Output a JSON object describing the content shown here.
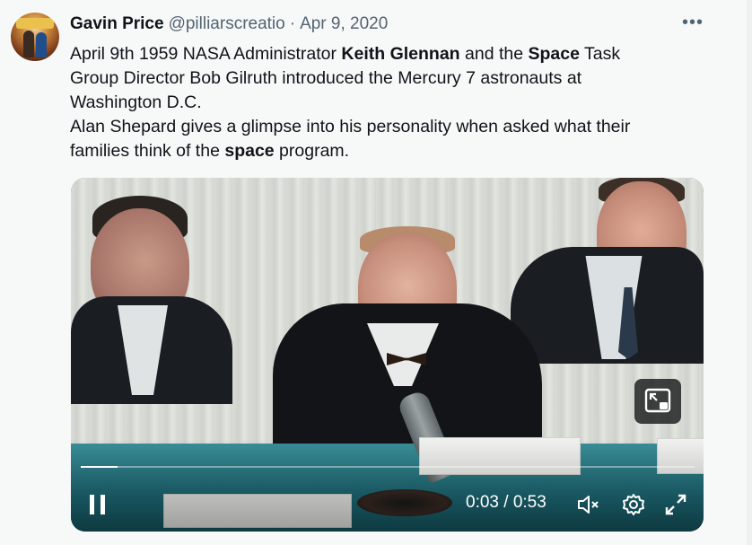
{
  "tweet": {
    "author_name": "Gavin Price",
    "author_handle": "@pilliarscreatio",
    "separator": "·",
    "date": "Apr 9, 2020",
    "more_label": "•••",
    "text": {
      "line1": {
        "pre": "April 9th 1959 NASA Administrator ",
        "bold1": "Keith Glennan",
        "mid": " and the ",
        "bold2": "Space",
        "post": " Task"
      },
      "line2": "Group Director Bob Gilruth introduced the Mercury 7 astronauts at",
      "line3": "Washington D.C.",
      "line4": "Alan Shepard gives a glimpse into his personality when asked what their",
      "line5": {
        "pre": "families think of the ",
        "bold": "space",
        "post": " program."
      }
    }
  },
  "video": {
    "current_time": "0:03",
    "time_separator": " / ",
    "duration": "0:53",
    "progress_fraction": 0.06,
    "controls": {
      "play_pause_icon": "pause-icon",
      "mute_icon": "volume-muted-icon",
      "settings_icon": "settings-gear-icon",
      "fullscreen_icon": "fullscreen-expand-icon",
      "pip_icon": "picture-in-picture-icon"
    }
  },
  "colors": {
    "text_primary": "#0f1419",
    "text_secondary": "#536471",
    "background": "#f7f9f9",
    "video_controls": "#ffffff"
  }
}
